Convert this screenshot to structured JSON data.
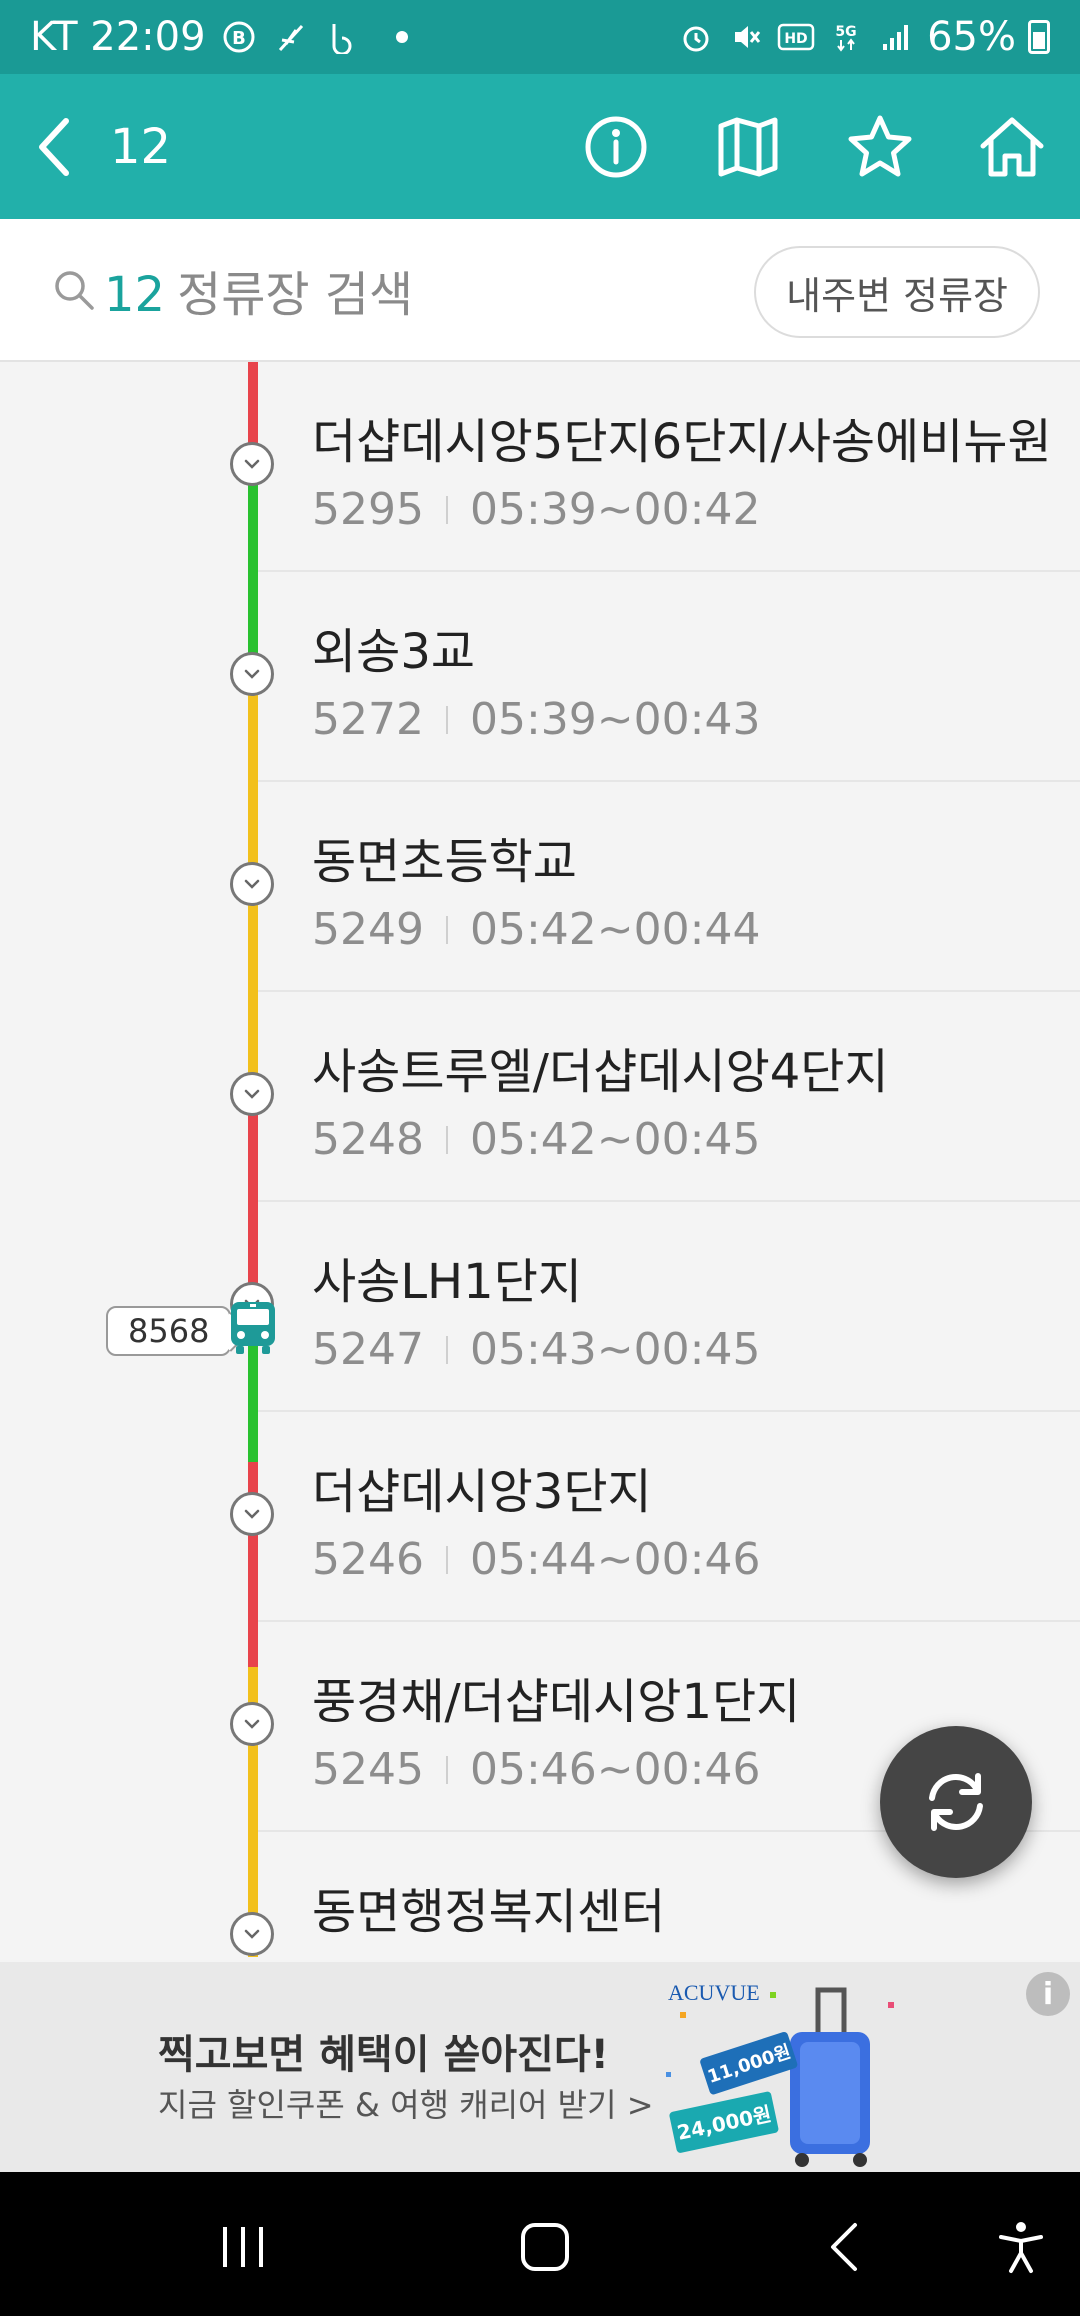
{
  "status_bar": {
    "carrier_time": "KT 22:09",
    "battery": "65%"
  },
  "app_bar": {
    "route_number": "12"
  },
  "search": {
    "route_number": "12",
    "placeholder": "정류장 검색",
    "nearby_button": "내주변 정류장"
  },
  "stops": [
    {
      "name": "더샵데시앙5단지6단지/사송에비뉴원",
      "code": "5295",
      "hours": "05:39~00:42"
    },
    {
      "name": "외송3교",
      "code": "5272",
      "hours": "05:39~00:43"
    },
    {
      "name": "동면초등학교",
      "code": "5249",
      "hours": "05:42~00:44"
    },
    {
      "name": "사송트루엘/더샵데시앙4단지",
      "code": "5248",
      "hours": "05:42~00:45"
    },
    {
      "name": "사송LH1단지",
      "code": "5247",
      "hours": "05:43~00:45"
    },
    {
      "name": "더샵데시앙3단지",
      "code": "5246",
      "hours": "05:44~00:46"
    },
    {
      "name": "풍경채/더샵데시앙1단지",
      "code": "5245",
      "hours": "05:46~00:46"
    },
    {
      "name": "동면행정복지센터",
      "code": "",
      "hours": ""
    }
  ],
  "bus": {
    "number": "8568"
  },
  "ad": {
    "headline": "찍고보면 혜택이 쏟아진다!",
    "subtext": "지금 할인쿠폰 & 여행 캐리어 받기 >",
    "brand": "ACUVUE",
    "coupon1": "11,000원",
    "coupon2": "24,000원"
  },
  "colors": {
    "status_bar": "#1a9a95",
    "app_bar": "#22b0aa",
    "accent": "#1aa39d",
    "traffic_red": "#e8434b",
    "traffic_green": "#29c12f",
    "traffic_yellow": "#f2c01c"
  }
}
